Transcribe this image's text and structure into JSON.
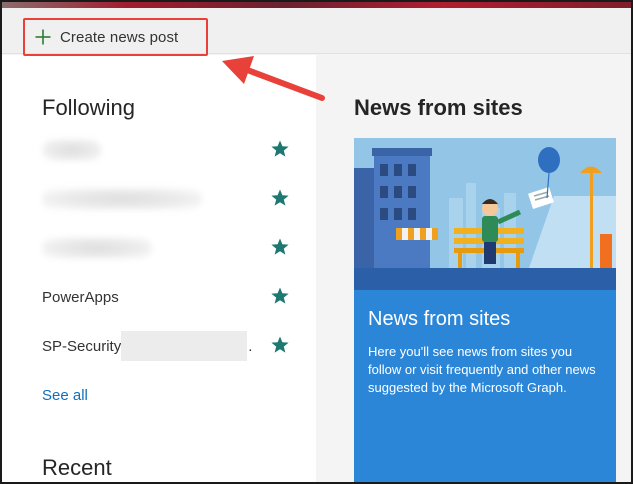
{
  "command_bar": {
    "create_label": "Create news post"
  },
  "following": {
    "title": "Following",
    "items": [
      {
        "name": "",
        "starred": true,
        "blurred": true
      },
      {
        "name": "",
        "starred": true,
        "blurred": true
      },
      {
        "name": "",
        "starred": true,
        "blurred": true
      },
      {
        "name": "PowerApps",
        "starred": true
      },
      {
        "name": "SP-Security",
        "starred": true,
        "suffix": "."
      }
    ],
    "see_all": "See all"
  },
  "recent": {
    "title": "Recent"
  },
  "news": {
    "heading": "News from sites",
    "card_title": "News from sites",
    "card_desc": "Here you'll see news from sites you follow or visit frequently and other news suggested by the Microsoft Graph."
  },
  "colors": {
    "accent_blue": "#2b86d8",
    "star_teal": "#1d7872",
    "highlight_red": "#e8413a",
    "link_blue": "#106ebe"
  },
  "icons": [
    "plus-icon",
    "star-icon",
    "arrow-annotation"
  ]
}
